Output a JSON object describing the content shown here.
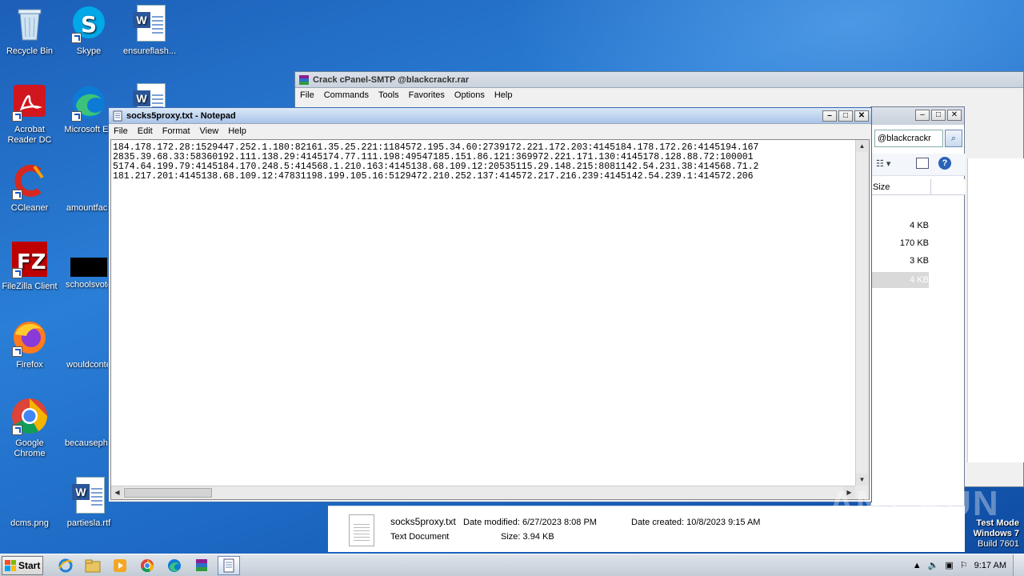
{
  "desktop": {
    "icons": [
      {
        "label": "Recycle Bin"
      },
      {
        "label": "Skype"
      },
      {
        "label": "ensureflash..."
      },
      {
        "label": "Acrobat Reader DC"
      },
      {
        "label": "Microsoft Ed"
      },
      {
        "label": "CCleaner"
      },
      {
        "label": "amountfacil"
      },
      {
        "label": "FileZilla Client"
      },
      {
        "label": "schoolsvote"
      },
      {
        "label": "Firefox"
      },
      {
        "label": "wouldconte"
      },
      {
        "label": "Google Chrome"
      },
      {
        "label": "becausepho"
      },
      {
        "label": "dcms.png"
      },
      {
        "label": "partiesla.rtf"
      }
    ]
  },
  "winrar": {
    "title": "Crack cPanel-SMTP @blackcrackr.rar",
    "menu": [
      "File",
      "Commands",
      "Tools",
      "Favorites",
      "Options",
      "Help"
    ]
  },
  "explorer": {
    "search_text": "@blackcrackr",
    "column_size": "Size",
    "sizes": [
      "4 KB",
      "170 KB",
      "3 KB",
      "4 KB"
    ],
    "details": {
      "filename": "socks5proxy.txt",
      "type": "Text Document",
      "modified_label": "Date modified:",
      "modified_value": "6/27/2023 8:08 PM",
      "size_label": "Size:",
      "size_value": "3.94 KB",
      "created_label": "Date created:",
      "created_value": "10/8/2023 9:15 AM"
    }
  },
  "notepad": {
    "title": "socks5proxy.txt - Notepad",
    "menu": [
      "File",
      "Edit",
      "Format",
      "View",
      "Help"
    ],
    "lines": [
      "184.178.172.28:1529447.252.1.180:82161.35.25.221:1184572.195.34.60:2739172.221.172.203:4145184.178.172.26:4145194.167",
      "2835.39.68.33:58360192.111.138.29:4145174.77.111.198:49547185.151.86.121:369972.221.171.130:4145178.128.88.72:100001",
      "5174.64.199.79:4145184.170.248.5:414568.1.210.163:4145138.68.109.12:20535115.29.148.215:8081142.54.231.38:414568.71.2",
      "181.217.201:4145138.68.109.12:47831198.199.105.16:5129472.210.252.137:414572.217.216.239:4145142.54.239.1:414572.206"
    ]
  },
  "watermark": "ANY RUN",
  "testmode": {
    "line1": "Test Mode",
    "line2": "Windows 7",
    "line3": "Build 7601"
  },
  "taskbar": {
    "start_label": "Start",
    "clock": "9:17 AM"
  },
  "colors": {
    "accent": "#1a56c0",
    "titlebar": "#c7d2e0"
  }
}
